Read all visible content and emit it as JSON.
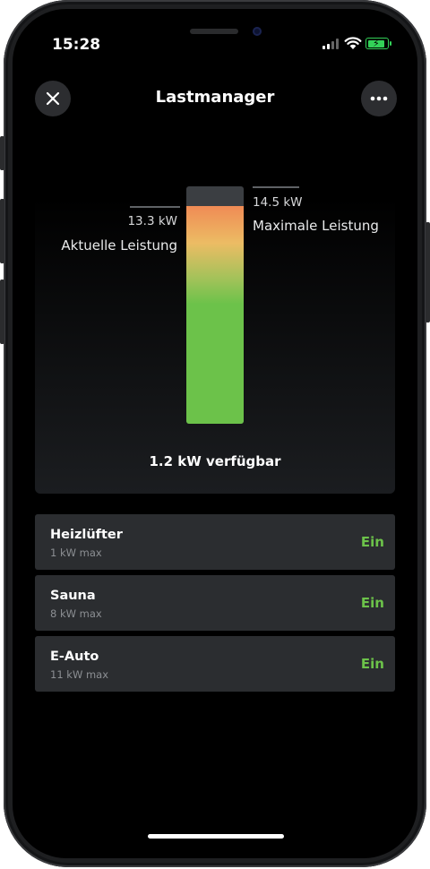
{
  "status_bar": {
    "time": "15:28"
  },
  "header": {
    "title": "Lastmanager"
  },
  "gauge": {
    "current_value": "13.3 kW",
    "current_label": "Aktuelle Leistung",
    "max_value": "14.5 kW",
    "max_label": "Maximale Leistung",
    "available_text": "1.2 kW verfügbar",
    "fill_fraction": 0.917
  },
  "devices": [
    {
      "name": "Heizlüfter",
      "max": "1 kW max",
      "state": "Ein"
    },
    {
      "name": "Sauna",
      "max": "8 kW max",
      "state": "Ein"
    },
    {
      "name": "E-Auto",
      "max": "11 kW max",
      "state": "Ein"
    }
  ],
  "colors": {
    "accent_green": "#6cc24a",
    "card": "#2b2d30"
  },
  "icons": {
    "close": "close-icon",
    "more": "more-icon"
  }
}
